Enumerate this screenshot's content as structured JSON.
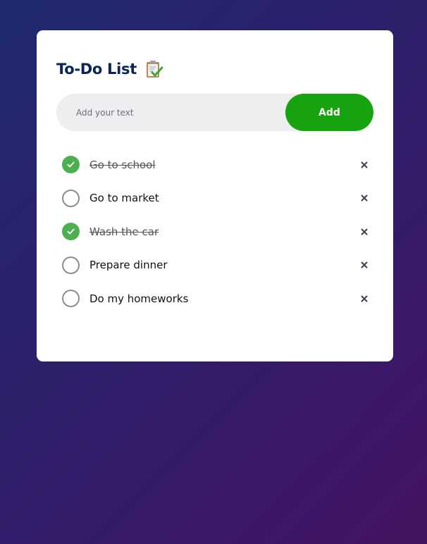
{
  "app": {
    "title": "To-Do List",
    "title_icon": "clipboard-check-icon",
    "accent_color": "#16a30f",
    "check_color": "#4caf50"
  },
  "input": {
    "placeholder": "Add your text",
    "value": ""
  },
  "add_button": {
    "label": "Add"
  },
  "tasks": [
    {
      "text": "Go to school",
      "done": true
    },
    {
      "text": "Go to market",
      "done": false
    },
    {
      "text": "Wash the car",
      "done": true
    },
    {
      "text": "Prepare dinner",
      "done": false
    },
    {
      "text": "Do my homeworks",
      "done": false
    }
  ],
  "icons": {
    "check": "checkmark-icon",
    "delete": "close-icon"
  }
}
